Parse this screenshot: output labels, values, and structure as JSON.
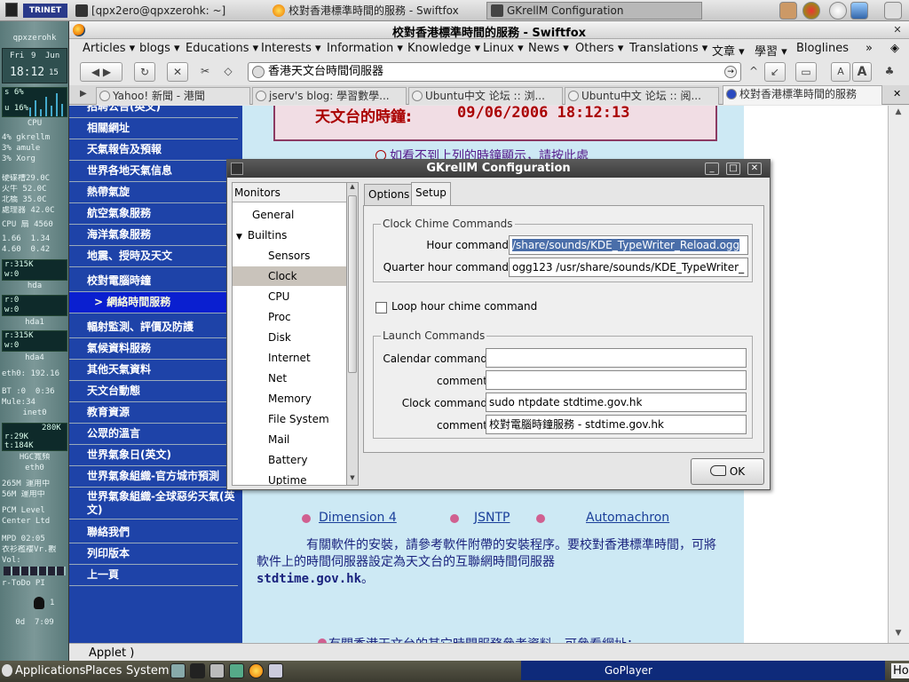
{
  "top_panel": {
    "tasks": [
      {
        "label": "[qpx2ero@qpxzerohk: ~]"
      },
      {
        "label": "校對香港標準時間的服務 - Swiftfox"
      },
      {
        "label": "GKrellM Configuration"
      }
    ]
  },
  "gkrellm": {
    "host": "qpxzerohk",
    "day": "Fri",
    "date": "9",
    "month": "Jun",
    "time": "18:12",
    "seconds": "15",
    "cpu_s": "s 6%",
    "cpu_u": "u 16%",
    "cpu_label": "CPU",
    "procs": [
      "4% gkrellm",
      "3% amule",
      "3% Xorg"
    ],
    "sensors": [
      "硬碟槽29.0C",
      "火牛 52.0C",
      "北橋 35.0C",
      "處理器 42.0C",
      "CPU 扇 4560"
    ],
    "load": [
      "1.66  1.34",
      "4.60  0.42"
    ],
    "hda_r": "r:315K",
    "hda_w": "w:0",
    "hda_label": "hda",
    "hda1_r": "r:0",
    "hda1_w": "w:0",
    "hda1_label": "hda1",
    "hda4_r": "r:315K",
    "hda4_w": "w:0",
    "hda4_label": "hda4",
    "eth0_ip": "eth0: 192.16",
    "bt": "BT :0  0:36",
    "mule": "Mule:34",
    "inet": "inet0",
    "net_r": "r:29K",
    "net_max": "280K",
    "net_t": "t:184K",
    "hgc": "HGC寬頻",
    "eth0_label": "eth0",
    "mem1": "265M 運用中",
    "mem2": "56M 運用中",
    "pcm": "PCM Level",
    "center": "Center Ltd",
    "mpd": "MPD 02:05",
    "song": "衣衫襤褸Vr.觀",
    "vol": "Vol:",
    "todo": "r-ToDo PI",
    "page": "1",
    "uptime": "0d  7:09"
  },
  "browser": {
    "title": "校對香港標準時間的服務 - Swiftfox",
    "bookmarks": [
      "Articles ▾",
      "blogs ▾",
      "Educations ▾",
      "Interests ▾",
      "Information ▾",
      "Knowledge ▾",
      "Linux ▾",
      "News ▾",
      "Others ▾",
      "Translations ▾",
      "文章 ▾",
      "學習 ▾",
      "Bloglines",
      "»"
    ],
    "url": "香港天文台時間伺服器",
    "tabs": [
      {
        "label": "Yahoo! 新聞 - 港聞"
      },
      {
        "label": "jserv's blog: 學習數學..."
      },
      {
        "label": "Ubuntu中文 论坛 :: 浏..."
      },
      {
        "label": "Ubuntu中文 论坛 :: 阅..."
      },
      {
        "label": "校對香港標準時間的服務"
      }
    ],
    "status": "Applet )"
  },
  "page": {
    "sidebar": [
      "招聘公告(英文)",
      "相關網址",
      "天氣報告及預報",
      "世界各地天氣信息",
      "熱帶氣旋",
      "航空氣象服務",
      "海洋氣象服務",
      "地震、授時及天文",
      "校對電腦時鐘",
      "> 網絡時間服務",
      "輻射監測、評價及防護",
      "氣候資料服務",
      "其他天氣資料",
      "天文台動態",
      "教育資源",
      "公眾的溫言",
      "世界氣象日(英文)",
      "世界氣象組織-官方城市預測",
      "世界氣象組織-全球惡劣天氣(英文)",
      "聯絡我們",
      "列印版本",
      "上一頁"
    ],
    "time_label": "天文台的時鐘:",
    "time_value": "09/06/2006 18:12:13",
    "warn_link": "如看不到上列的時鐘顯示，請按此處",
    "links": [
      "Dimension 4",
      "JSNTP",
      "Automachron"
    ],
    "para_text": "有關軟件的安裝，請參考軟件附帶的安裝程序。要校對香港標準時間，可將軟件上的時間伺服器設定為天文台的互聯網時間伺服器",
    "para_server": "stdtime.gov.hk",
    "para_end": "。",
    "ref_text": "有關香港天文台的其它時間服務參考資料，可參看網址："
  },
  "dialog": {
    "title": "GKrellM Configuration",
    "tree_header": "Monitors",
    "tree": [
      {
        "label": "General",
        "level": 1
      },
      {
        "label": "Builtins",
        "level": 1,
        "expanded": true
      },
      {
        "label": "Sensors",
        "level": 2
      },
      {
        "label": "Clock",
        "level": 2,
        "selected": true
      },
      {
        "label": "CPU",
        "level": 2
      },
      {
        "label": "Proc",
        "level": 2
      },
      {
        "label": "Disk",
        "level": 2
      },
      {
        "label": "Internet",
        "level": 2
      },
      {
        "label": "Net",
        "level": 2
      },
      {
        "label": "Memory",
        "level": 2
      },
      {
        "label": "File System",
        "level": 2
      },
      {
        "label": "Mail",
        "level": 2
      },
      {
        "label": "Battery",
        "level": 2
      },
      {
        "label": "Uptime",
        "level": 2
      }
    ],
    "tabs": [
      "Options",
      "Setup"
    ],
    "active_tab": "Setup",
    "chime": {
      "legend": "Clock Chime Commands",
      "hour_label": "Hour command",
      "hour_value": "/share/sounds/KDE_TypeWriter_Reload.ogg",
      "quarter_label": "Quarter hour command",
      "quarter_value": "ogg123 /usr/share/sounds/KDE_TypeWriter_"
    },
    "loop_label": "Loop hour chime command",
    "loop_checked": false,
    "launch": {
      "legend": "Launch Commands",
      "calendar_label": "Calendar command",
      "calendar_value": "",
      "comment1_label": "comment",
      "comment1_value": "",
      "clock_label": "Clock command",
      "clock_value": "sudo ntpdate stdtime.gov.hk",
      "comment2_label": "comment",
      "comment2_value": "校對電腦時鐘服務 - stdtime.gov.hk"
    },
    "ok_label": "OK"
  },
  "bottom_panel": {
    "applications": "Applications",
    "places": "Places",
    "system": "System",
    "goplayer": "GoPlayer",
    "corner": "Ho"
  }
}
